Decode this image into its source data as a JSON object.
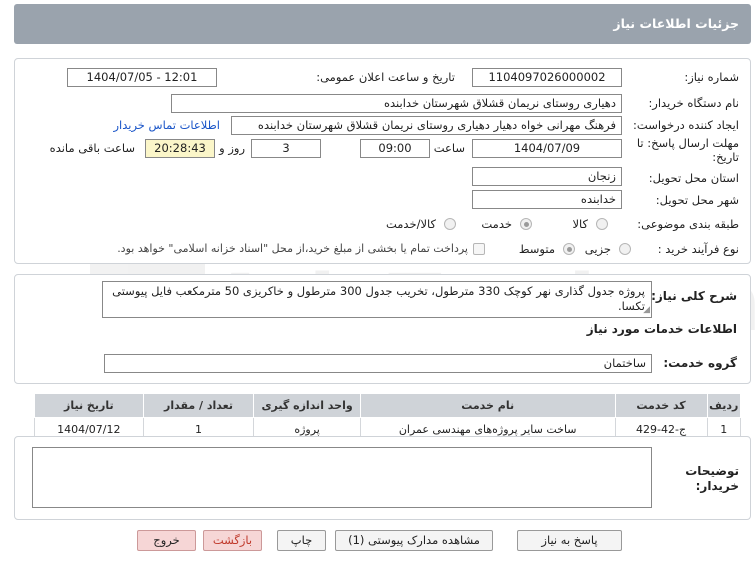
{
  "header": {
    "title": "جزئیات اطلاعات نیاز"
  },
  "form": {
    "need_number_label": "شماره نیاز:",
    "need_number": "1104097026000002",
    "announce_label": "تاریخ و ساعت اعلان عمومی:",
    "announce_value": "1404/07/05 - 12:01",
    "buyer_org_label": "نام دستگاه خریدار:",
    "buyer_org": "دهیاری روستای نریمان قشلاق شهرستان خدابنده",
    "requester_label": "ایجاد کننده درخواست:",
    "requester": "فرهنگ مهرانی خواه دهیار دهیاری روستای نریمان قشلاق شهرستان خدابنده",
    "contact_link": "اطلاعات تماس خریدار",
    "deadline_label_1": "مهلت ارسال پاسخ: تا",
    "deadline_label_2": "تاریخ:",
    "deadline_date": "1404/07/09",
    "time_label": "ساعت",
    "deadline_time": "09:00",
    "days_value": "3",
    "days_label": "روز و",
    "remaining_time": "20:28:43",
    "remaining_label": "ساعت باقی مانده",
    "province_label": "استان محل تحویل:",
    "province": "زنجان",
    "city_label": "شهر محل تحویل:",
    "city": "خدابنده",
    "category_label": "طبقه بندی موضوعی:",
    "category_options": [
      "کالا",
      "خدمت",
      "کالا/خدمت"
    ],
    "category_selected": "خدمت",
    "process_label": "نوع فرآیند خرید :",
    "process_options": [
      "جزیی",
      "متوسط"
    ],
    "process_selected": "متوسط",
    "payment_note": "پرداخت تمام یا بخشی از مبلغ خرید،از محل \"اسناد خزانه اسلامی\" خواهد بود."
  },
  "description": {
    "label": "شرح کلی نیاز:",
    "text": "پروژه جدول گذاری نهر کوچک 330 مترطول،  تخریب جدول 300 مترطول  و خاکریزی 50 مترمکعب فایل پیوستی تکسا."
  },
  "services": {
    "section_title": "اطلاعات خدمات مورد نیاز",
    "group_label": "گروه خدمت:",
    "group_value": "ساختمان",
    "columns": [
      "ردیف",
      "کد خدمت",
      "نام خدمت",
      "واحد اندازه گیری",
      "تعداد / مقدار",
      "تاریخ نیاز"
    ],
    "rows": [
      [
        "1",
        "ج-42-429",
        "ساخت سایر پروژه‌های مهندسی عمران",
        "پروژه",
        "1",
        "1404/07/12"
      ]
    ]
  },
  "buyer_notes": {
    "label_1": "توضیحات",
    "label_2": "خریدار:",
    "value": ""
  },
  "buttons": {
    "reply": "پاسخ به نیاز",
    "attachments": "مشاهده مدارک پیوستی (1)",
    "print": "چاپ",
    "back": "بازگشت",
    "exit": "خروج"
  }
}
